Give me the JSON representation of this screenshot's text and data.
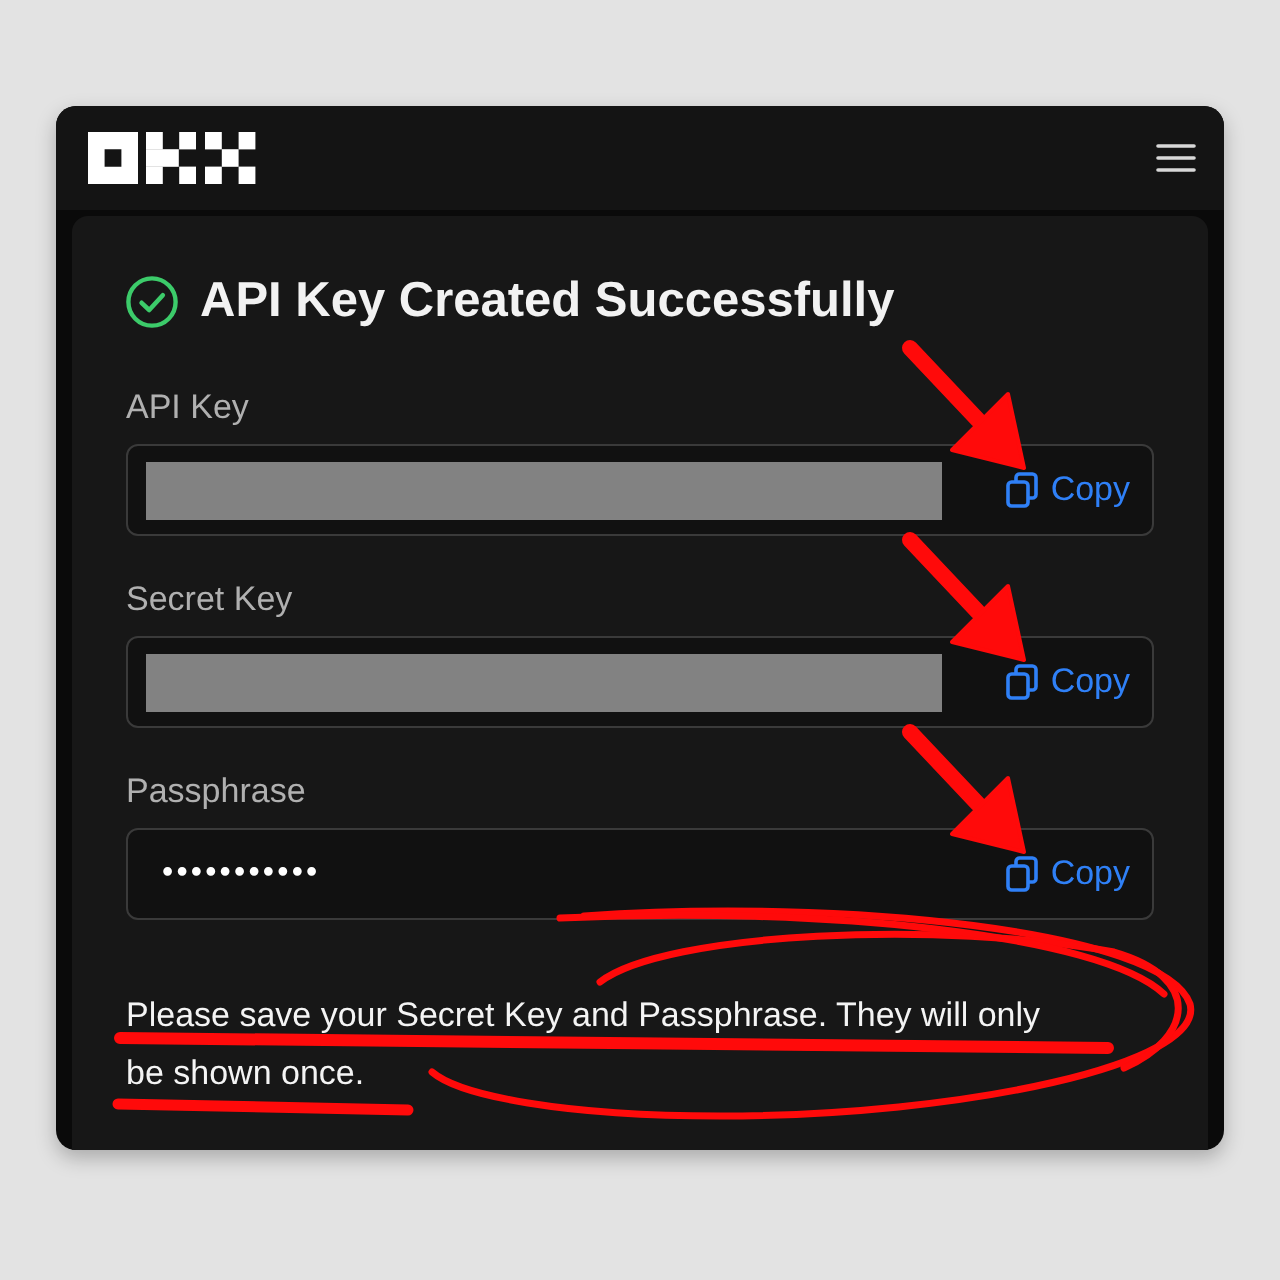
{
  "title": "API Key Created Successfully",
  "fields": [
    {
      "label": "API Key",
      "kind": "redacted",
      "copy_label": "Copy",
      "arrow": true
    },
    {
      "label": "Secret Key",
      "kind": "redacted",
      "copy_label": "Copy",
      "arrow": true
    },
    {
      "label": "Passphrase",
      "kind": "masked",
      "value": "•••••••••••",
      "copy_label": "Copy",
      "arrow": true
    }
  ],
  "note": {
    "text": "Please save your Secret Key and Passphrase. They will only be shown once.",
    "circled": true,
    "underlined": true
  }
}
